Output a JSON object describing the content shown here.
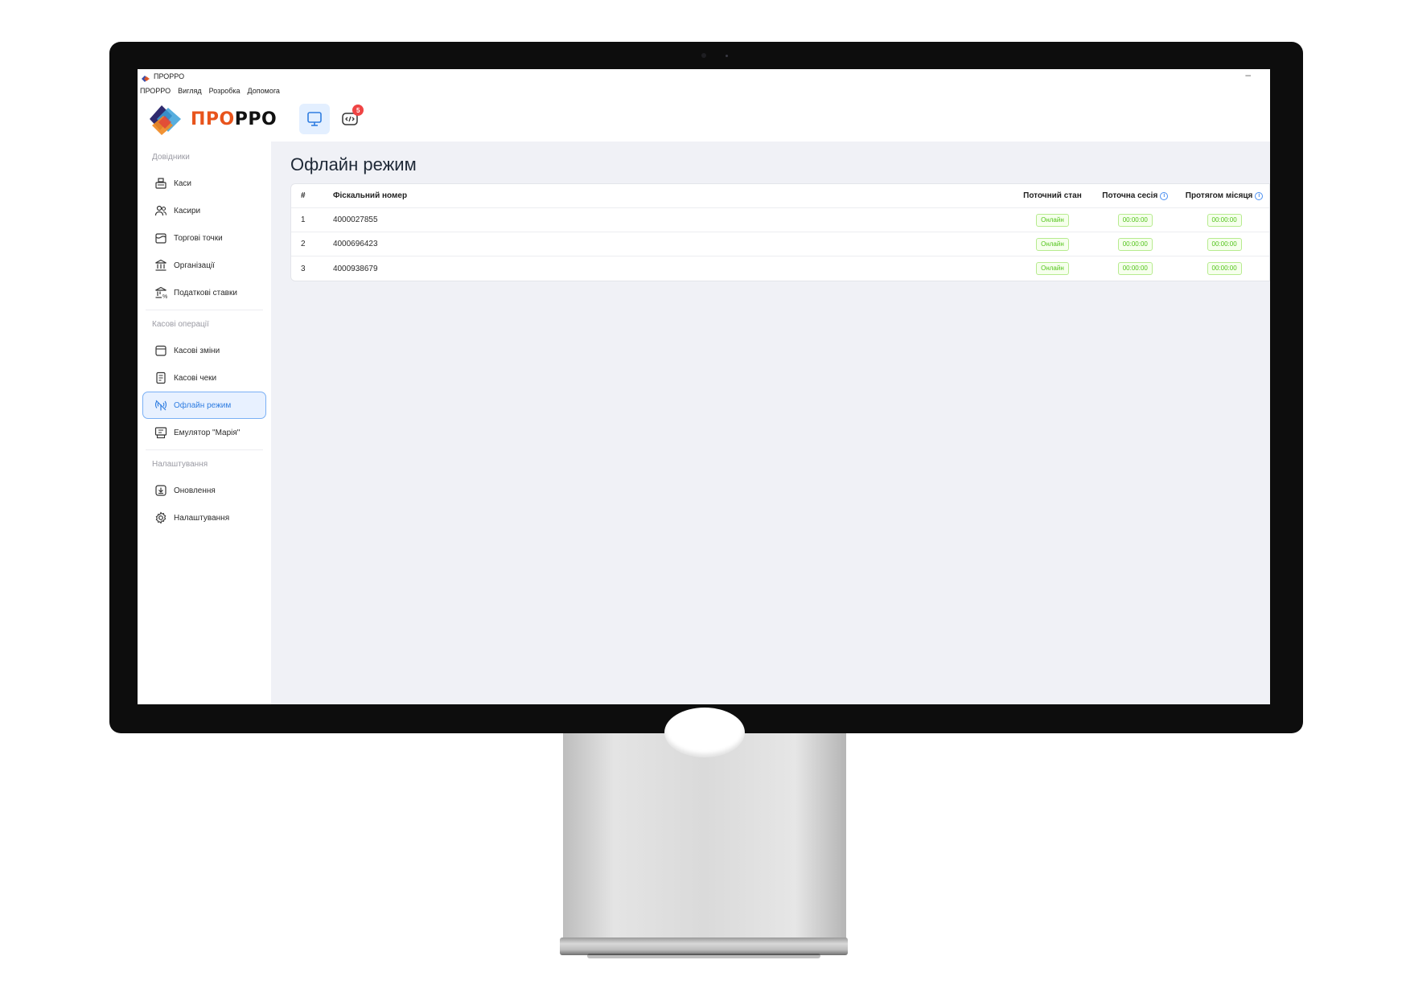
{
  "window": {
    "title": "ПРОРРО",
    "minimize_glyph": "–"
  },
  "menu": [
    "ПРОРРО",
    "Вигляд",
    "Розробка",
    "Допомога"
  ],
  "logo": {
    "part1": "ПРО",
    "part2": "РРО"
  },
  "header": {
    "buttons": [
      {
        "icon": "monitor-icon",
        "active": true
      },
      {
        "icon": "code-icon",
        "active": false,
        "badge": "5"
      }
    ]
  },
  "sidebar": {
    "sections": [
      {
        "label": "Довідники",
        "items": [
          {
            "label": "Каси",
            "icon": "cash-register-icon"
          },
          {
            "label": "Касири",
            "icon": "users-icon"
          },
          {
            "label": "Торгові точки",
            "icon": "store-icon"
          },
          {
            "label": "Організації",
            "icon": "bank-icon"
          },
          {
            "label": "Податкові ставки",
            "icon": "tax-icon"
          }
        ]
      },
      {
        "label": "Касові операції",
        "items": [
          {
            "label": "Касові зміни",
            "icon": "calendar-icon"
          },
          {
            "label": "Касові чеки",
            "icon": "receipt-icon"
          },
          {
            "label": "Офлайн режим",
            "icon": "offline-icon",
            "active": true
          },
          {
            "label": "Емулятор \"Марія\"",
            "icon": "emulator-icon"
          }
        ]
      },
      {
        "label": "Налаштування",
        "items": [
          {
            "label": "Оновлення",
            "icon": "download-icon"
          },
          {
            "label": "Налаштування",
            "icon": "gear-icon"
          }
        ]
      }
    ]
  },
  "page": {
    "title": "Офлайн режим",
    "table": {
      "headers": [
        "#",
        "Фіскальний номер",
        "Поточний стан",
        "Поточна сесія",
        "Протягом місяця"
      ],
      "info_glyph": "i",
      "rows": [
        {
          "num": "1",
          "fiscal": "4000027855",
          "state": "Онлайн",
          "session": "00:00:00",
          "month": "00:00:00"
        },
        {
          "num": "2",
          "fiscal": "4000696423",
          "state": "Онлайн",
          "session": "00:00:00",
          "month": "00:00:00"
        },
        {
          "num": "3",
          "fiscal": "4000938679",
          "state": "Онлайн",
          "session": "00:00:00",
          "month": "00:00:00"
        }
      ]
    }
  },
  "colors": {
    "accent": "#2f7de1",
    "status_green": "#52c41a",
    "badge_red": "#ef4444",
    "content_bg": "#f0f1f6"
  }
}
